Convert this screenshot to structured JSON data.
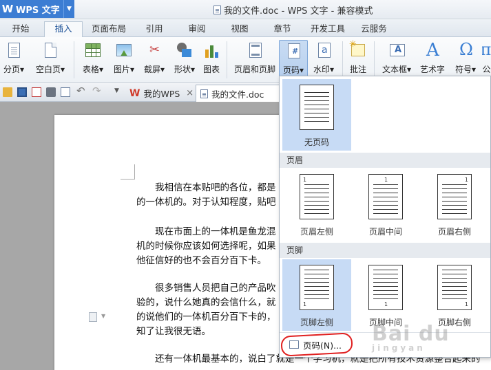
{
  "app": {
    "name": "WPS 文字",
    "logo": "W",
    "window_title": "我的文件.doc - WPS 文字 - 兼容模式"
  },
  "menu_tabs": [
    "开始",
    "插入",
    "页面布局",
    "引用",
    "审阅",
    "视图",
    "章节",
    "开发工具",
    "云服务"
  ],
  "active_tab": "插入",
  "ribbon": {
    "page_break": "分页",
    "blank_page": "空白页",
    "table": "表格",
    "picture": "图片",
    "screenshot": "截屏",
    "shape": "形状",
    "chart": "图表",
    "header_footer": "页眉和页脚",
    "page_number": "页码",
    "watermark": "水印",
    "comment": "批注",
    "textbox": "文本框",
    "wordart": "艺术字",
    "symbol": "符号",
    "formula_partial": "公"
  },
  "doc_tabs": [
    {
      "label": "我的WPS",
      "active": false
    },
    {
      "label": "我的文件.doc",
      "active": true
    }
  ],
  "document": {
    "paragraphs": [
      [
        "我相信在本贴吧的各位，都是",
        "的一体机的。对于认知程度，贴吧"
      ],
      [
        "现在市面上的一体机是鱼龙混",
        "机的时候你应该如何选择呢，如果",
        "他征信好的也不会百分百下卡。"
      ],
      [
        "很多销售人员把自己的产品吹",
        "验的，说什么她真的会信什么，就",
        "的说他们的一体机百分百下卡的，",
        "知了让我很无语。"
      ],
      [
        "还有一体机最基本的，说白了就是一个学习机，就是把所有技术资源整合起来的"
      ]
    ]
  },
  "dropdown": {
    "none_label": "无页码",
    "header_section": "页眉",
    "header_items": [
      "页眉左侧",
      "页眉中间",
      "页眉右侧"
    ],
    "footer_section": "页脚",
    "footer_items": [
      "页脚左侧",
      "页脚中间",
      "页脚右侧"
    ],
    "footer_button": "页码(N)...",
    "thumb_number": "1"
  },
  "watermark": {
    "text": "Bai du",
    "sub": "jingyan"
  }
}
